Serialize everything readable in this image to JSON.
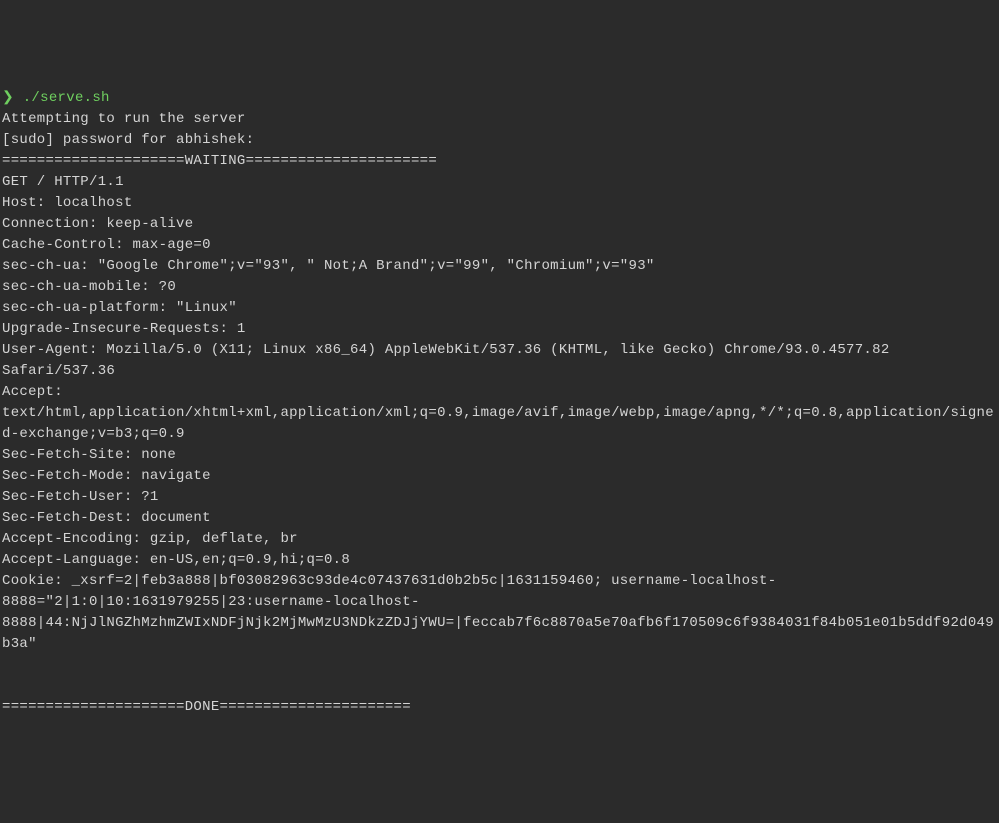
{
  "prompt": {
    "symbol": "❯",
    "command": "./serve.sh"
  },
  "output": {
    "line1": "Attempting to run the server",
    "line2": "[sudo] password for abhishek:",
    "line3": "=====================WAITING======================",
    "line4": "GET / HTTP/1.1",
    "line5": "Host: localhost",
    "line6": "Connection: keep-alive",
    "line7": "Cache-Control: max-age=0",
    "line8": "sec-ch-ua: \"Google Chrome\";v=\"93\", \" Not;A Brand\";v=\"99\", \"Chromium\";v=\"93\"",
    "line9": "sec-ch-ua-mobile: ?0",
    "line10": "sec-ch-ua-platform: \"Linux\"",
    "line11": "Upgrade-Insecure-Requests: 1",
    "line12": "User-Agent: Mozilla/5.0 (X11; Linux x86_64) AppleWebKit/537.36 (KHTML, like Gecko) Chrome/93.0.4577.82 Safari/537.36",
    "line13": "Accept: text/html,application/xhtml+xml,application/xml;q=0.9,image/avif,image/webp,image/apng,*/*;q=0.8,application/signed-exchange;v=b3;q=0.9",
    "line14": "Sec-Fetch-Site: none",
    "line15": "Sec-Fetch-Mode: navigate",
    "line16": "Sec-Fetch-User: ?1",
    "line17": "Sec-Fetch-Dest: document",
    "line18": "Accept-Encoding: gzip, deflate, br",
    "line19": "Accept-Language: en-US,en;q=0.9,hi;q=0.8",
    "line20": "Cookie: _xsrf=2|feb3a888|bf03082963c93de4c07437631d0b2b5c|1631159460; username-localhost-8888=\"2|1:0|10:1631979255|23:username-localhost-8888|44:NjJlNGZhMzhmZWIxNDFjNjk2MjMwMzU3NDkzZDJjYWU=|feccab7f6c8870a5e70afb6f170509c6f9384031f84b051e01b5ddf92d049b3a\"",
    "line21": "",
    "line22": "",
    "line23": "=====================DONE======================"
  }
}
